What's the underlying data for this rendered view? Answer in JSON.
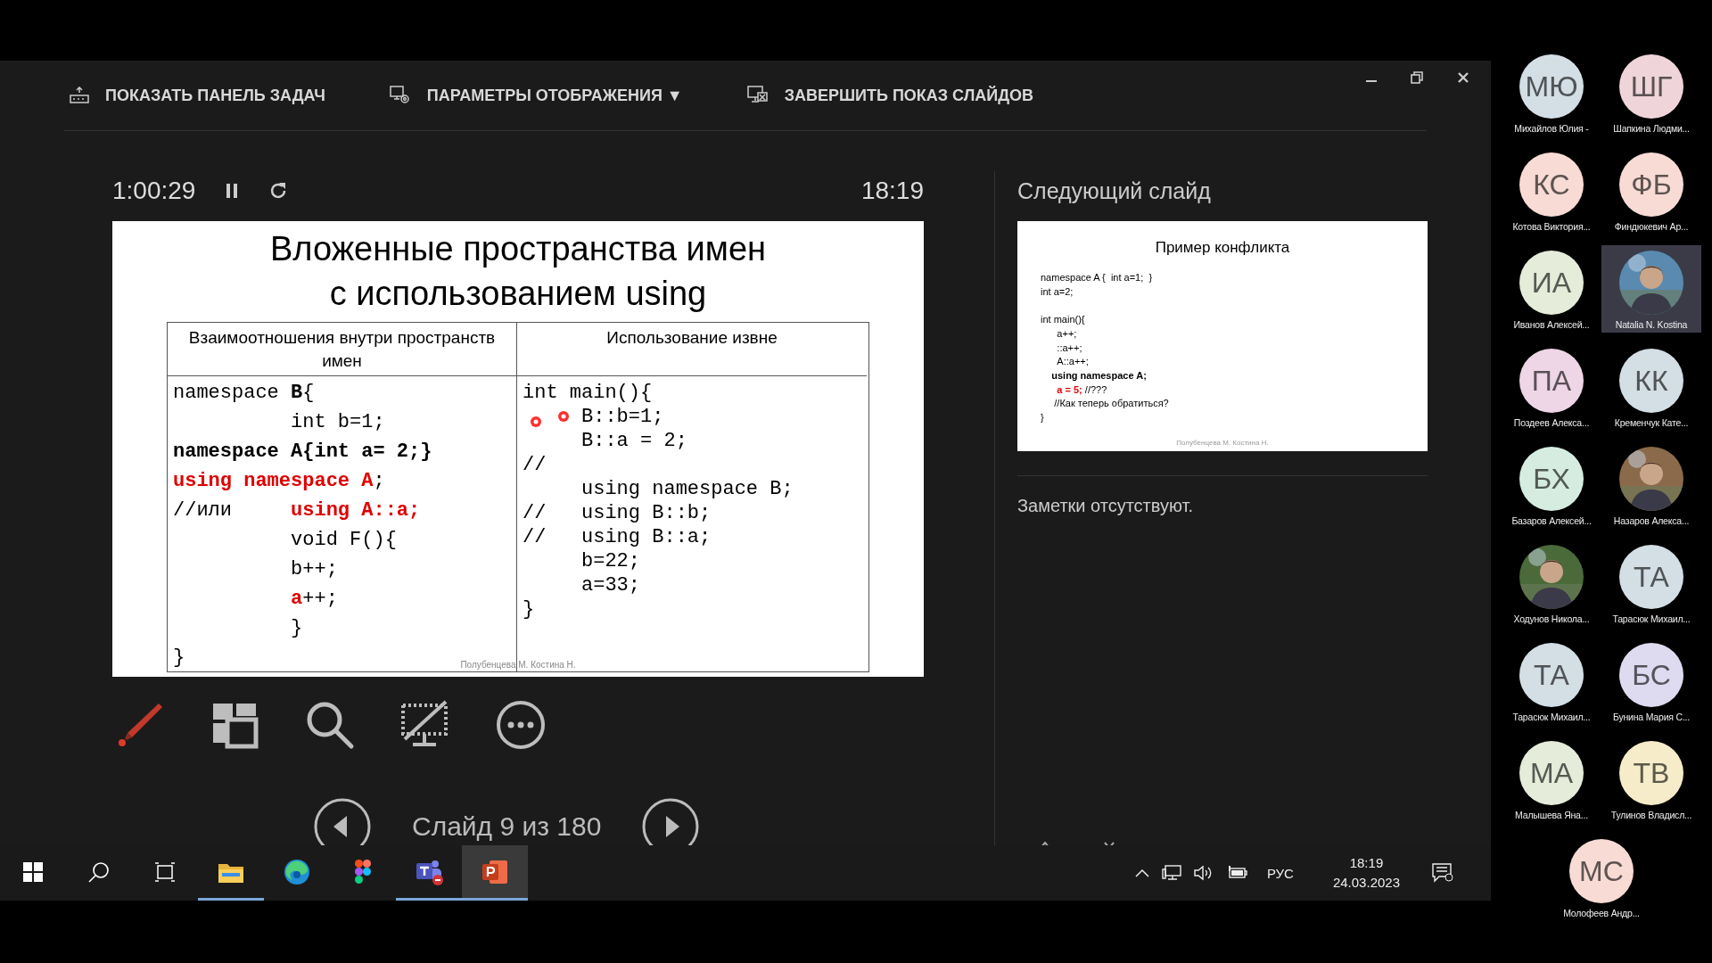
{
  "toolbar": {
    "items": [
      {
        "kind": "taskbar",
        "label": "ПОКАЗАТЬ ПАНЕЛЬ ЗАДАЧ"
      },
      {
        "kind": "display",
        "label": "ПАРАМЕТРЫ ОТОБРАЖЕНИЯ ▼"
      },
      {
        "kind": "end",
        "label": "ЗАВЕРШИТЬ ПОКАЗ СЛАЙДОВ"
      }
    ]
  },
  "timer": {
    "elapsed": "1:00:29",
    "clock": "18:19"
  },
  "current_slide": {
    "title_lines": [
      "Вложенные пространства имен",
      "с использованием  using"
    ],
    "columns": [
      {
        "header": "Взаимоотношения внутри пространств имен",
        "lines": [
          [
            {
              "text": "namespace ",
              "kind": "plain"
            },
            {
              "text": "B",
              "kind": "bold"
            },
            {
              "text": "{",
              "kind": "plain"
            }
          ],
          [
            {
              "text": "          int b=1;",
              "kind": "plain"
            }
          ],
          [
            {
              "text": "namespace A{int a= 2;}",
              "kind": "bold"
            }
          ],
          [
            {
              "text": "using namespace A",
              "kind": "red"
            },
            {
              "text": ";",
              "kind": "plain"
            }
          ],
          [
            {
              "text": "//или     ",
              "kind": "plain"
            },
            {
              "text": "using A::a;",
              "kind": "red"
            }
          ],
          [
            {
              "text": "          void F(){",
              "kind": "plain"
            }
          ],
          [
            {
              "text": "          b++;",
              "kind": "plain"
            }
          ],
          [
            {
              "text": "          a",
              "kind": "red"
            },
            {
              "text": "++;",
              "kind": "plain"
            }
          ],
          [
            {
              "text": "          }",
              "kind": "plain"
            }
          ],
          [
            {
              "text": "}",
              "kind": "plain"
            }
          ]
        ]
      },
      {
        "header": "Использование извне",
        "lines": [
          [
            {
              "text": "int main(){",
              "kind": "plain"
            }
          ],
          [
            {
              "text": "     B::b=1;",
              "kind": "plain"
            }
          ],
          [
            {
              "text": "     B::a = 2;",
              "kind": "plain"
            }
          ],
          [
            {
              "text": "//",
              "kind": "plain"
            }
          ],
          [
            {
              "text": "     using namespace B;",
              "kind": "plain"
            }
          ],
          [
            {
              "text": "//   using B::b;",
              "kind": "plain"
            }
          ],
          [
            {
              "text": "//   using B::a;",
              "kind": "plain"
            }
          ],
          [
            {
              "text": "     b=22;",
              "kind": "plain"
            }
          ],
          [
            {
              "text": "     a=33;",
              "kind": "plain"
            }
          ],
          [
            {
              "text": "}",
              "kind": "plain"
            }
          ]
        ]
      }
    ],
    "footer": "Полубенцева М. Костина Н."
  },
  "next_slide": {
    "label": "Следующий слайд",
    "title": "Пример конфликта",
    "code_blocks": [
      [
        [
          {
            "text": "namespace A {  int a=1;  }",
            "kind": "plain"
          }
        ],
        [
          {
            "text": "int a=2;",
            "kind": "plain"
          }
        ]
      ],
      [
        [
          {
            "text": "int main(){",
            "kind": "plain"
          }
        ],
        [
          {
            "text": "      a++;",
            "kind": "plain"
          }
        ],
        [
          {
            "text": "      ::a++;",
            "kind": "plain"
          }
        ],
        [
          {
            "text": "      A::a++;",
            "kind": "plain"
          }
        ],
        [
          {
            "text": "    using namespace A;",
            "kind": "bold"
          }
        ],
        [
          {
            "text": "      a = 5;",
            "kind": "red"
          },
          {
            "text": " //???",
            "kind": "plain"
          }
        ],
        [
          {
            "text": "     //Как теперь обратиться?",
            "kind": "plain"
          }
        ],
        [
          {
            "text": "}",
            "kind": "plain"
          }
        ]
      ]
    ],
    "footer": "Полубенцева М. Костина Н."
  },
  "notes": "Заметки отсутствуют.",
  "tools": [
    {
      "kind": "pen"
    },
    {
      "kind": "slides"
    },
    {
      "kind": "zoom"
    },
    {
      "kind": "screen"
    },
    {
      "kind": "more"
    }
  ],
  "navigation": {
    "counter": "Слайд 9 из 180"
  },
  "participants": [
    {
      "kind": "initials",
      "initials": "МЮ",
      "name": "Михайлов Юлия -",
      "color": "#d3dee5",
      "highlighted": false
    },
    {
      "kind": "initials",
      "initials": "ШГ",
      "name": "Шапкина Людми...",
      "color": "#efd5da",
      "highlighted": false
    },
    {
      "kind": "initials",
      "initials": "КС",
      "name": "Котова Виктория...",
      "color": "#f7dbd4",
      "highlighted": false
    },
    {
      "kind": "initials",
      "initials": "ФБ",
      "name": "Финдюкевич Ар...",
      "color": "#f7dbd4",
      "highlighted": false
    },
    {
      "kind": "initials",
      "initials": "ИА",
      "name": "Иванов Алексей...",
      "color": "#e5ecda",
      "highlighted": false
    },
    {
      "name": "Natalia N. Kostina",
      "highlighted": true
    },
    {
      "kind": "initials",
      "initials": "ПА",
      "name": "Поздеев Алекса...",
      "color": "#eed6e6",
      "highlighted": false
    },
    {
      "kind": "initials",
      "initials": "КК",
      "name": "Кременчук Кате...",
      "color": "#d3dee5",
      "highlighted": false
    },
    {
      "kind": "initials",
      "initials": "БХ",
      "name": "Базаров Алексей...",
      "color": "#d6ece0",
      "highlighted": false
    },
    {
      "name": "Назаров Алекса...",
      "highlighted": false
    },
    {
      "name": "Ходунов Никола...",
      "highlighted": false
    },
    {
      "kind": "initials",
      "initials": "ТА",
      "name": "Тарасюк Михаил...",
      "color": "#d3dee5",
      "highlighted": false
    },
    {
      "kind": "initials",
      "initials": "ТА",
      "name": "Тарасюк Михаил...",
      "color": "#d3dee5",
      "highlighted": false
    },
    {
      "kind": "initials",
      "initials": "БС",
      "name": "Бунина Мария С...",
      "color": "#dedaf0",
      "highlighted": false
    },
    {
      "kind": "initials",
      "initials": "МА",
      "name": "Малышева Яна...",
      "color": "#e5ecda",
      "highlighted": false
    },
    {
      "kind": "initials",
      "initials": "ТВ",
      "name": "Тулинов Владисл...",
      "color": "#f6ecc9",
      "highlighted": false
    },
    {
      "kind": "initials",
      "initials": "МС",
      "name": "Молофеев Андр...",
      "color": "#f7dbd4",
      "highlighted": false
    }
  ],
  "taskbar": {
    "apps": [
      {
        "kind": "start",
        "running": false,
        "active": false
      },
      {
        "kind": "search",
        "running": false,
        "active": false
      },
      {
        "kind": "taskview",
        "running": false,
        "active": false
      },
      {
        "kind": "explorer",
        "running": true,
        "active": false
      },
      {
        "kind": "edge",
        "running": false,
        "active": false
      },
      {
        "kind": "figma",
        "running": false,
        "active": false
      },
      {
        "kind": "teams",
        "running": true,
        "active": false
      },
      {
        "kind": "powerpoint",
        "running": true,
        "active": true
      }
    ],
    "language": "РУС",
    "time": "18:19",
    "date": "24.03.2023"
  }
}
